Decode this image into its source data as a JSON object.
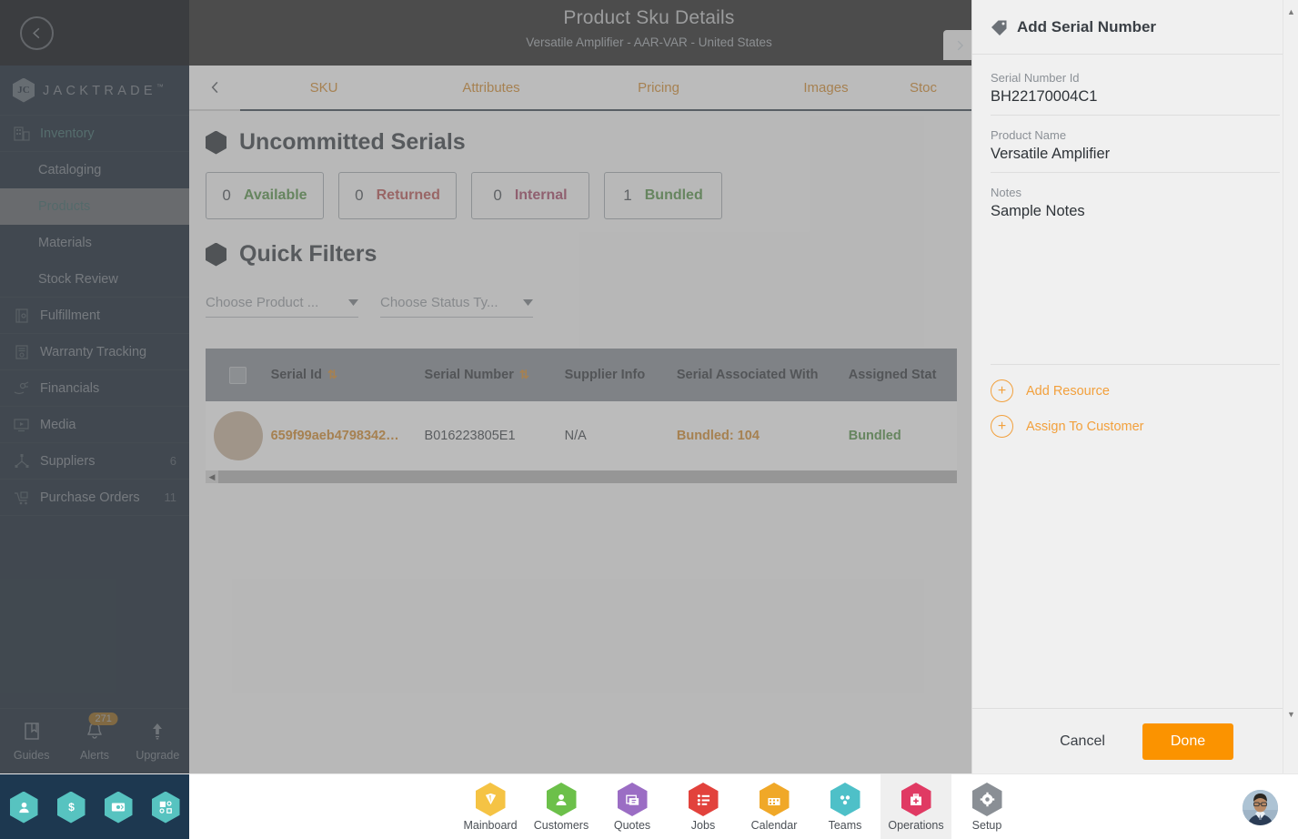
{
  "topbar": {
    "title": "Product Sku Details",
    "subtitle": "Versatile Amplifier - AAR-VAR - United States",
    "back_icon": "chevron-left-icon",
    "forward_icon": "chevron-right-icon"
  },
  "sidebar": {
    "brand": "JACKTRADE",
    "brand_mark": "™",
    "brand_monogram": "JC",
    "items": [
      {
        "label": "Inventory",
        "icon": "inventory-icon",
        "type": "group",
        "active": true,
        "badge": ""
      },
      {
        "label": "Cataloging",
        "icon": "",
        "type": "sub",
        "active": false,
        "badge": ""
      },
      {
        "label": "Products",
        "icon": "",
        "type": "sub",
        "active": true,
        "badge": ""
      },
      {
        "label": "Materials",
        "icon": "",
        "type": "sub",
        "active": false,
        "badge": ""
      },
      {
        "label": "Stock Review",
        "icon": "",
        "type": "sub",
        "active": false,
        "badge": ""
      },
      {
        "label": "Fulfillment",
        "icon": "fulfillment-icon",
        "type": "group",
        "active": false,
        "badge": ""
      },
      {
        "label": "Warranty Tracking",
        "icon": "warranty-icon",
        "type": "group",
        "active": false,
        "badge": ""
      },
      {
        "label": "Financials",
        "icon": "financials-icon",
        "type": "group",
        "active": false,
        "badge": ""
      },
      {
        "label": "Media",
        "icon": "media-icon",
        "type": "group",
        "active": false,
        "badge": ""
      },
      {
        "label": "Suppliers",
        "icon": "suppliers-icon",
        "type": "group",
        "active": false,
        "badge": "6"
      },
      {
        "label": "Purchase Orders",
        "icon": "purchase-icon",
        "type": "group",
        "active": false,
        "badge": "11"
      }
    ],
    "footer": {
      "guides": "Guides",
      "alerts": "Alerts",
      "alerts_count": "271",
      "upgrade": "Upgrade"
    }
  },
  "main": {
    "tabs": [
      {
        "label": "SKU"
      },
      {
        "label": "Attributes"
      },
      {
        "label": "Pricing"
      },
      {
        "label": "Images"
      },
      {
        "label": "Stoc"
      }
    ],
    "serials_section_title": "Uncommitted Serials",
    "stats": [
      {
        "count": "0",
        "label": "Available",
        "color": "#4a8a3c"
      },
      {
        "count": "0",
        "label": "Returned",
        "color": "#b44a4a"
      },
      {
        "count": "0",
        "label": "Internal",
        "color": "#a23e5e"
      },
      {
        "count": "1",
        "label": "Bundled",
        "color": "#4a8a3c"
      }
    ],
    "quick_filters_title": "Quick Filters",
    "filters": [
      {
        "placeholder": "Choose Product ..."
      },
      {
        "placeholder": "Choose Status Ty..."
      }
    ],
    "table": {
      "columns": [
        "Serial Id",
        "Serial Number",
        "Supplier Info",
        "Serial Associated With",
        "Assigned Stat"
      ],
      "rows": [
        {
          "serial_id": "659f99aeb4798342…",
          "serial_number": "B016223805E1",
          "supplier_info": "N/A",
          "associated_with": "Bundled: 104",
          "assigned_status": "Bundled"
        }
      ]
    }
  },
  "panel": {
    "title": "Add Serial Number",
    "icon": "tag-icon",
    "fields": [
      {
        "label": "Serial Number Id",
        "value": "BH22170004C1"
      },
      {
        "label": "Product Name",
        "value": "Versatile Amplifier"
      },
      {
        "label": "Notes",
        "value": "Sample Notes"
      }
    ],
    "actions": [
      {
        "label": "Add Resource",
        "icon": "plus-circle-icon"
      },
      {
        "label": "Assign To Customer",
        "icon": "plus-circle-icon"
      }
    ],
    "cancel_label": "Cancel",
    "done_label": "Done"
  },
  "bottombar": {
    "items": [
      {
        "label": "Mainboard",
        "color": "#f5c344",
        "icon": "mainboard-icon",
        "active": false
      },
      {
        "label": "Customers",
        "color": "#6cc04a",
        "icon": "customers-icon",
        "active": false
      },
      {
        "label": "Quotes",
        "color": "#9b6dc4",
        "icon": "quotes-icon",
        "active": false
      },
      {
        "label": "Jobs",
        "color": "#e2423c",
        "icon": "jobs-icon",
        "active": false
      },
      {
        "label": "Calendar",
        "color": "#f0a828",
        "icon": "calendar-icon",
        "active": false
      },
      {
        "label": "Teams",
        "color": "#4ec0c8",
        "icon": "teams-icon",
        "active": false
      },
      {
        "label": "Operations",
        "color": "#e03a63",
        "icon": "operations-icon",
        "active": true
      },
      {
        "label": "Setup",
        "color": "#8a8f95",
        "icon": "setup-icon",
        "active": false
      }
    ],
    "quick_icons": [
      "user-icon",
      "dollar-icon",
      "payment-icon",
      "workflow-icon"
    ]
  },
  "colors": {
    "accent_orange": "#d0821f",
    "done_orange": "#fb9300",
    "sidebar_bg": "#263643",
    "topbar_bg": "#131313"
  }
}
